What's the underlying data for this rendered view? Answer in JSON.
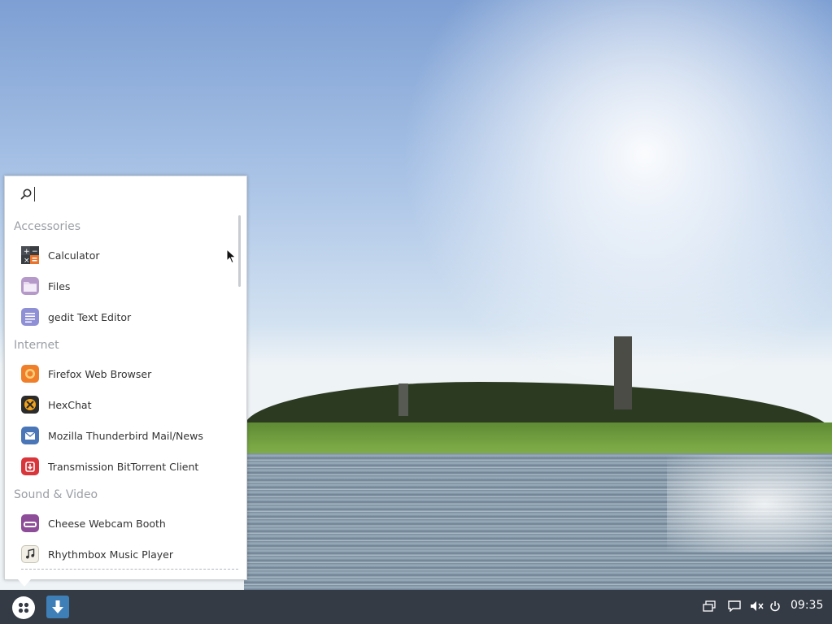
{
  "menu": {
    "search": {
      "placeholder": "",
      "value": ""
    },
    "categories": [
      {
        "name": "Accessories",
        "items": [
          {
            "label": "Calculator",
            "icon": "calculator-icon"
          },
          {
            "label": "Files",
            "icon": "files-icon"
          },
          {
            "label": "gedit Text Editor",
            "icon": "text-editor-icon"
          }
        ]
      },
      {
        "name": "Internet",
        "items": [
          {
            "label": "Firefox Web Browser",
            "icon": "firefox-icon"
          },
          {
            "label": "HexChat",
            "icon": "hexchat-icon"
          },
          {
            "label": "Mozilla Thunderbird Mail/News",
            "icon": "thunderbird-icon"
          },
          {
            "label": "Transmission BitTorrent Client",
            "icon": "transmission-icon"
          }
        ]
      },
      {
        "name": "Sound & Video",
        "items": [
          {
            "label": "Cheese Webcam Booth",
            "icon": "cheese-icon"
          },
          {
            "label": "Rhythmbox Music Player",
            "icon": "rhythmbox-icon"
          }
        ]
      }
    ]
  },
  "panel": {
    "clock": "09:35",
    "tray_icons": [
      "window-switcher-icon",
      "notifications-icon",
      "volume-muted-icon",
      "power-icon"
    ]
  },
  "colors": {
    "panel_bg": "#343b45",
    "task_button": "#3f7fb8",
    "category_text": "#9a9ea4"
  }
}
